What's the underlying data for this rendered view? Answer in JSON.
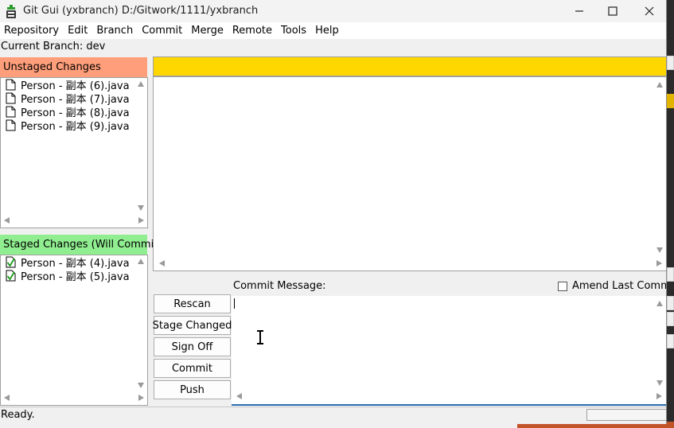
{
  "window": {
    "title": "Git Gui (yxbranch) D:/Gitwork/1111/yxbranch",
    "app_icon": "git-gui-icon",
    "controls": [
      "minimize-icon",
      "maximize-icon",
      "close-icon"
    ]
  },
  "menu": {
    "items": [
      "Repository",
      "Edit",
      "Branch",
      "Commit",
      "Merge",
      "Remote",
      "Tools",
      "Help"
    ]
  },
  "branch_label": "Current Branch: dev",
  "unstaged": {
    "title": "Unstaged Changes",
    "color": "#ff9e7a",
    "files": [
      "Person - 副本 (6).java",
      "Person - 副本 (7).java",
      "Person - 副本 (8).java",
      "Person - 副本 (9).java"
    ]
  },
  "staged": {
    "title": "Staged Changes (Will Commit)",
    "color": "#90ee90",
    "files": [
      "Person - 副本 (4).java",
      "Person - 副本 (5).java"
    ]
  },
  "diff": {
    "header_color": "#ffd700"
  },
  "commit": {
    "message_label": "Commit Message:",
    "amend_label": "Amend Last Commit",
    "amend_checked": false,
    "message_value": ""
  },
  "buttons": {
    "rescan": "Rescan",
    "stage_changed": "Stage Changed",
    "sign_off": "Sign Off",
    "commit": "Commit",
    "push": "Push"
  },
  "status": "Ready."
}
